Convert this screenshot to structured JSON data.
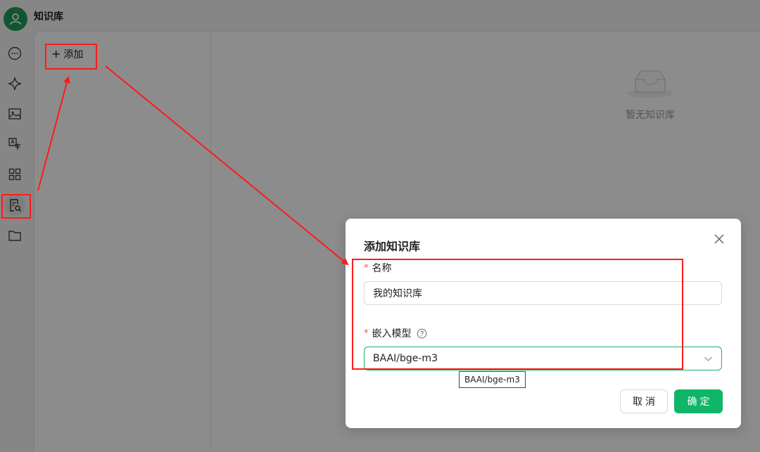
{
  "app": {
    "title": "知识库",
    "accent_color": "#10b567",
    "avatar_icon": "user-icon"
  },
  "rail": {
    "items": [
      {
        "icon": "chat-bubble-icon",
        "active": false
      },
      {
        "icon": "sparkle-icon",
        "active": false
      },
      {
        "icon": "image-icon",
        "active": false
      },
      {
        "icon": "translate-icon",
        "active": false
      },
      {
        "icon": "apps-grid-icon",
        "active": false
      },
      {
        "icon": "knowledge-search-icon",
        "active": true
      },
      {
        "icon": "folder-icon",
        "active": false
      }
    ]
  },
  "kb_list": {
    "add_label": "添加"
  },
  "empty_state": {
    "icon": "empty-inbox-icon",
    "text": "暂无知识库"
  },
  "modal": {
    "title": "添加知识库",
    "name_label": "名称",
    "name_value": "我的知识库",
    "model_label": "嵌入模型",
    "model_value": "BAAI/bge-m3",
    "tooltip": "BAAI/bge-m3",
    "cancel_label": "取消",
    "ok_label": "确定"
  },
  "annotation_color": "#ff1a1a"
}
